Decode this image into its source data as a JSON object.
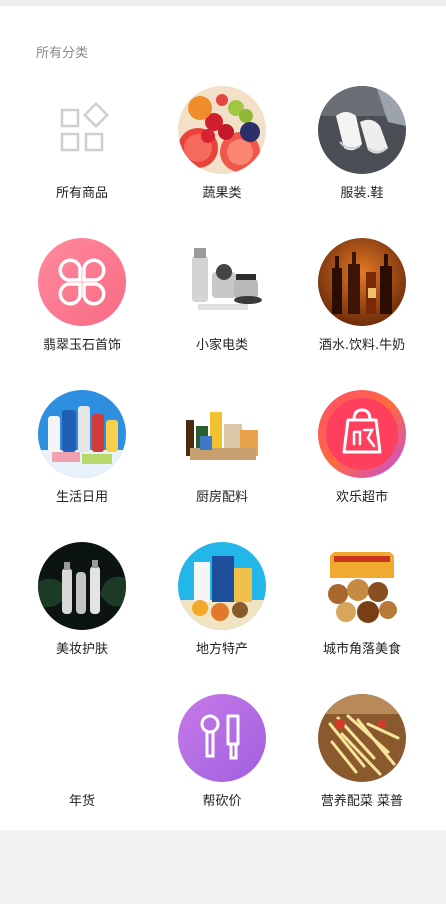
{
  "section_title": "所有分类",
  "categories": [
    {
      "label": "所有商品",
      "icon": "grid-icon"
    },
    {
      "label": "蔬果类",
      "icon": "fruit-photo"
    },
    {
      "label": "服装.鞋",
      "icon": "shoes-photo"
    },
    {
      "label": "翡翠玉石首饰",
      "icon": "clover-icon"
    },
    {
      "label": "小家电类",
      "icon": "appliance-photo"
    },
    {
      "label": "酒水.饮料.牛奶",
      "icon": "liquor-photo"
    },
    {
      "label": "生活日用",
      "icon": "daily-goods-photo"
    },
    {
      "label": "厨房配料",
      "icon": "kitchen-photo"
    },
    {
      "label": "欢乐超市",
      "icon": "shopping-bag-icon"
    },
    {
      "label": "美妆护肤",
      "icon": "cosmetics-photo"
    },
    {
      "label": "地方特产",
      "icon": "specialty-photo"
    },
    {
      "label": "城市角落美食",
      "icon": "snacks-photo"
    },
    {
      "label": "年货",
      "icon": "none"
    },
    {
      "label": "帮砍价",
      "icon": "knife-icon"
    },
    {
      "label": "营养配菜 菜普",
      "icon": "vegetable-photo"
    }
  ],
  "colors": {
    "section_title": "#8a8a8a",
    "label": "#222222",
    "pink_gradient": "#ff7b93",
    "purple_gradient": "#b06ee6"
  }
}
